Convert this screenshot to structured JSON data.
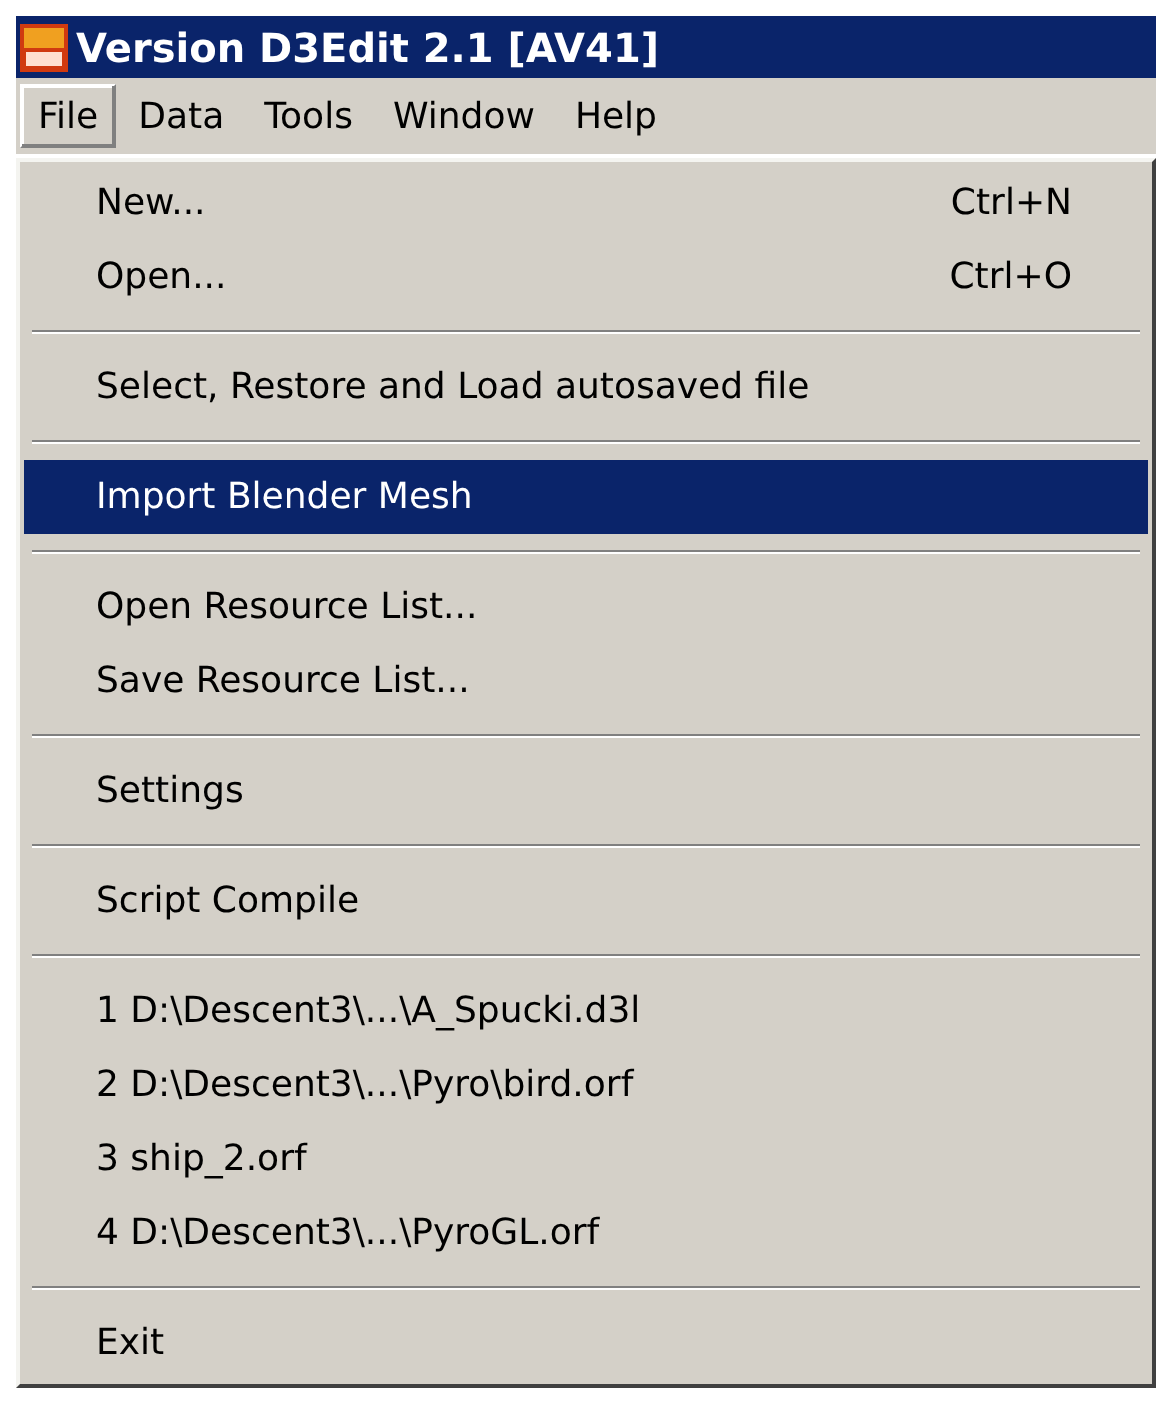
{
  "window": {
    "title": "Version D3Edit 2.1 [AV41]"
  },
  "menu_bar": [
    {
      "label": "File",
      "selected": true
    },
    {
      "label": "Data",
      "selected": false
    },
    {
      "label": "Tools",
      "selected": false
    },
    {
      "label": "Window",
      "selected": false
    },
    {
      "label": "Help",
      "selected": false
    }
  ],
  "file_menu": [
    {
      "kind": "item",
      "label": "New...",
      "shortcut": "Ctrl+N",
      "selected": false
    },
    {
      "kind": "item",
      "label": "Open...",
      "shortcut": "Ctrl+O",
      "selected": false
    },
    {
      "kind": "separator"
    },
    {
      "kind": "item",
      "label": "Select, Restore and Load autosaved file",
      "selected": false
    },
    {
      "kind": "separator"
    },
    {
      "kind": "item",
      "label": "Import Blender Mesh",
      "selected": true
    },
    {
      "kind": "separator"
    },
    {
      "kind": "item",
      "label": "Open Resource List...",
      "selected": false
    },
    {
      "kind": "item",
      "label": "Save Resource List...",
      "selected": false
    },
    {
      "kind": "separator"
    },
    {
      "kind": "item",
      "label": "Settings",
      "selected": false
    },
    {
      "kind": "separator"
    },
    {
      "kind": "item",
      "label": "Script Compile",
      "selected": false
    },
    {
      "kind": "separator"
    },
    {
      "kind": "item",
      "label": "1 D:\\Descent3\\...\\A_Spucki.d3l",
      "selected": false
    },
    {
      "kind": "item",
      "label": "2 D:\\Descent3\\...\\Pyro\\bird.orf",
      "selected": false
    },
    {
      "kind": "item",
      "label": "3 ship_2.orf",
      "selected": false
    },
    {
      "kind": "item",
      "label": "4 D:\\Descent3\\...\\PyroGL.orf",
      "selected": false
    },
    {
      "kind": "separator"
    },
    {
      "kind": "item",
      "label": "Exit",
      "selected": false
    }
  ]
}
